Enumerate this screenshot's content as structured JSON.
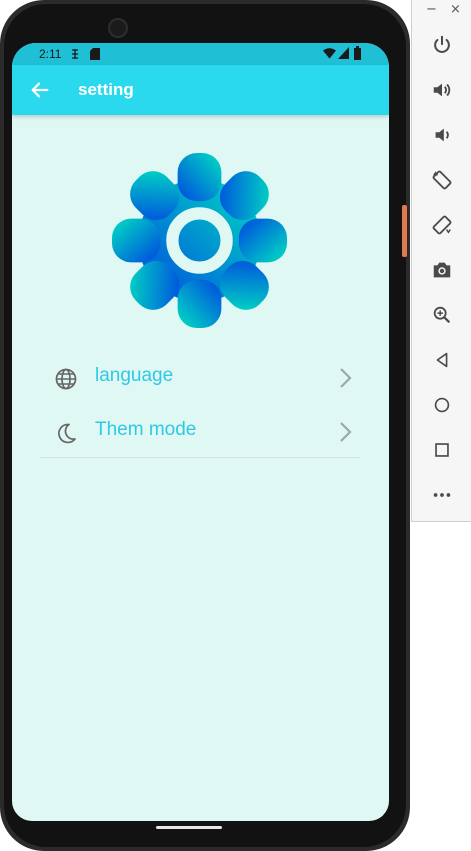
{
  "status_bar": {
    "time": "2:11"
  },
  "app_bar": {
    "title": "setting"
  },
  "settings_items": [
    {
      "label": "language",
      "icon": "globe-icon"
    },
    {
      "label": "Them mode",
      "icon": "moon-icon"
    }
  ],
  "colors": {
    "app_bar": "#2ad9ee",
    "screen_background": "#e0f8f4",
    "item_label": "#2ec9e3",
    "gear_gradient_start": "#0046e0",
    "gear_gradient_end": "#00e0c0"
  },
  "emulator_toolbar": {
    "window_controls": [
      "−",
      "×"
    ],
    "buttons": [
      "power-icon",
      "volume-up-icon",
      "volume-down-icon",
      "rotate-left-icon",
      "rotate-right-icon",
      "camera-icon",
      "zoom-icon",
      "back-icon",
      "home-icon",
      "overview-icon",
      "more-icon"
    ]
  }
}
